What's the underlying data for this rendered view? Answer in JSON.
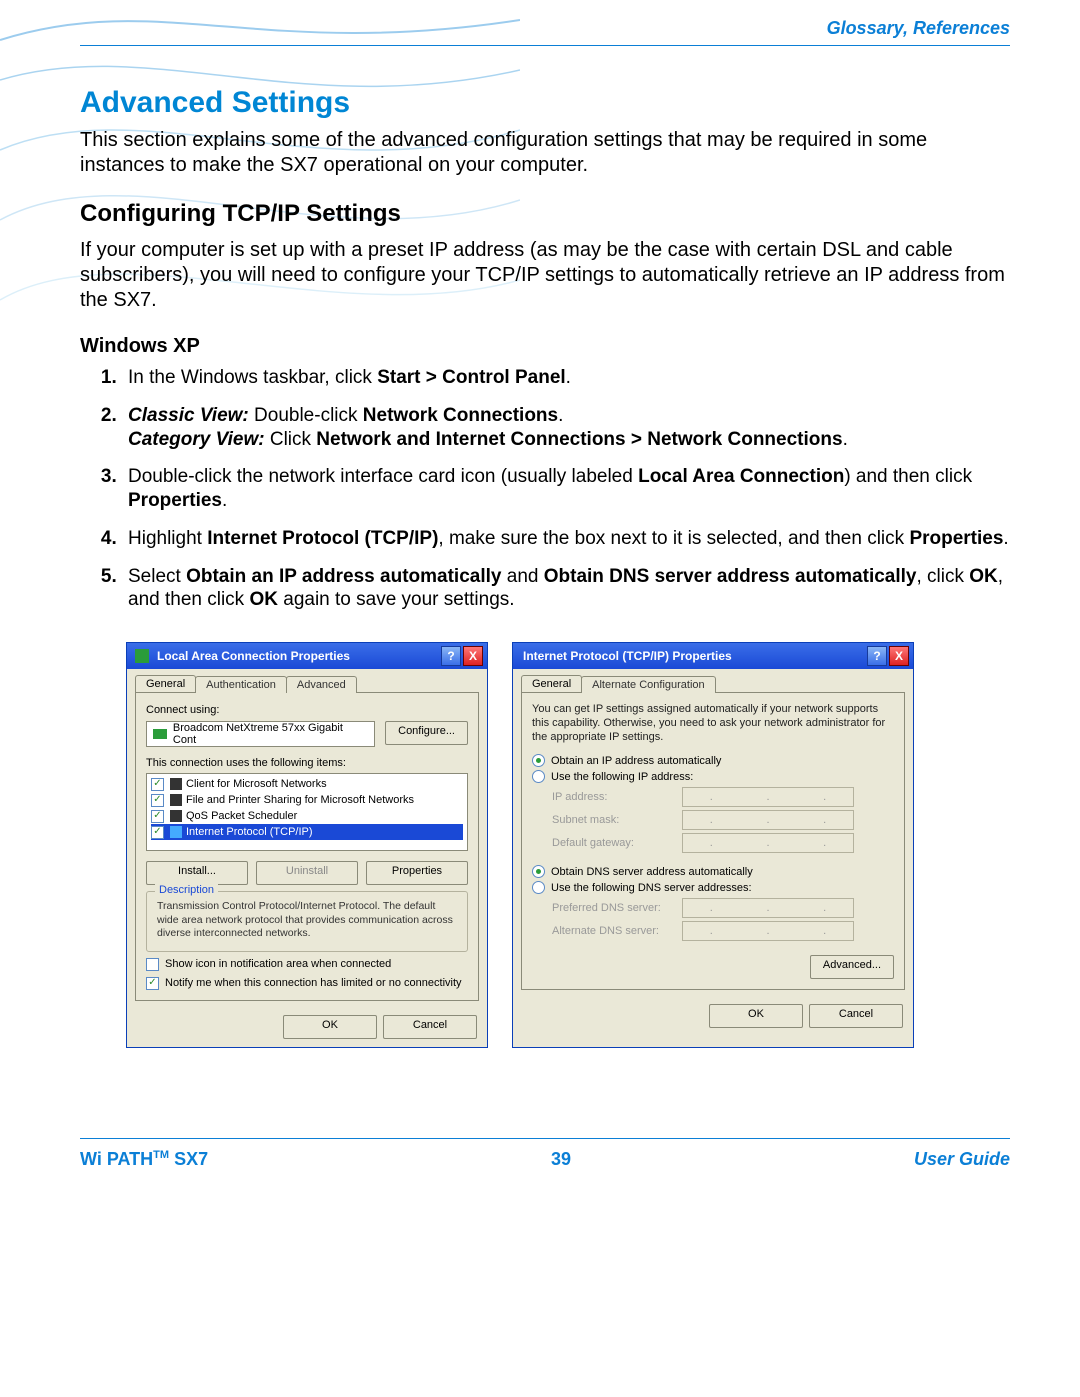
{
  "header": {
    "link": "Glossary, References"
  },
  "h1": "Advanced Settings",
  "intro": "This section explains some of the advanced configuration settings that may be required in some instances to make the SX7 operational on your computer.",
  "h2": "Configuring TCP/IP Settings",
  "tcpip_intro": "If your computer is set up with a preset IP address (as may be the case with certain DSL and cable subscribers), you will need to configure your TCP/IP settings to automatically retrieve an IP address from the SX7.",
  "h3": "Windows XP",
  "steps": {
    "s1_a": "In the Windows taskbar, click ",
    "s1_b": "Start > Control Panel",
    "s1_c": ".",
    "s2_view1": "Classic View:",
    "s2_a": " Double-click ",
    "s2_b": "Network Connections",
    "s2_c": ".",
    "s2_view2": "Category View:",
    "s2_d": " Click ",
    "s2_e": "Network and Internet Connections > Network Connections",
    "s2_f": ".",
    "s3_a": "Double-click the network interface card icon (usually labeled ",
    "s3_b": "Local Area Connection",
    "s3_c": ") and then click ",
    "s3_d": "Properties",
    "s3_e": ".",
    "s4_a": "Highlight ",
    "s4_b": "Internet Protocol (TCP/IP)",
    "s4_c": ", make sure the box next to it is selected, and then click ",
    "s4_d": "Properties",
    "s4_e": ".",
    "s5_a": "Select ",
    "s5_b": "Obtain an IP address automatically",
    "s5_c": " and ",
    "s5_d": "Obtain DNS server address automatically",
    "s5_e": ", click ",
    "s5_f": "OK",
    "s5_g": ", and then click ",
    "s5_h": "OK",
    "s5_i": " again to save your settings."
  },
  "dlg1": {
    "title": "Local Area Connection Properties",
    "tabs": [
      "General",
      "Authentication",
      "Advanced"
    ],
    "connect_using": "Connect using:",
    "nic": "Broadcom NetXtreme 57xx Gigabit Cont",
    "configure": "Configure...",
    "uses_items": "This connection uses the following items:",
    "items": [
      "Client for Microsoft Networks",
      "File and Printer Sharing for Microsoft Networks",
      "QoS Packet Scheduler",
      "Internet Protocol (TCP/IP)"
    ],
    "install": "Install...",
    "uninstall": "Uninstall",
    "properties": "Properties",
    "desc_legend": "Description",
    "desc": "Transmission Control Protocol/Internet Protocol. The default wide area network protocol that provides communication across diverse interconnected networks.",
    "show_icon": "Show icon in notification area when connected",
    "notify": "Notify me when this connection has limited or no connectivity",
    "ok": "OK",
    "cancel": "Cancel"
  },
  "dlg2": {
    "title": "Internet Protocol (TCP/IP) Properties",
    "tabs": [
      "General",
      "Alternate Configuration"
    ],
    "info": "You can get IP settings assigned automatically if your network supports this capability. Otherwise, you need to ask your network administrator for the appropriate IP settings.",
    "opt_auto_ip": "Obtain an IP address automatically",
    "opt_use_ip": "Use the following IP address:",
    "ip_label": "IP address:",
    "subnet_label": "Subnet mask:",
    "gw_label": "Default gateway:",
    "opt_auto_dns": "Obtain DNS server address automatically",
    "opt_use_dns": "Use the following DNS server addresses:",
    "pdns_label": "Preferred DNS server:",
    "adns_label": "Alternate DNS server:",
    "advanced": "Advanced...",
    "ok": "OK",
    "cancel": "Cancel"
  },
  "footer": {
    "left_a": "Wi PATH",
    "left_b": " SX7",
    "tm": "TM",
    "page": "39",
    "right": "User Guide"
  }
}
